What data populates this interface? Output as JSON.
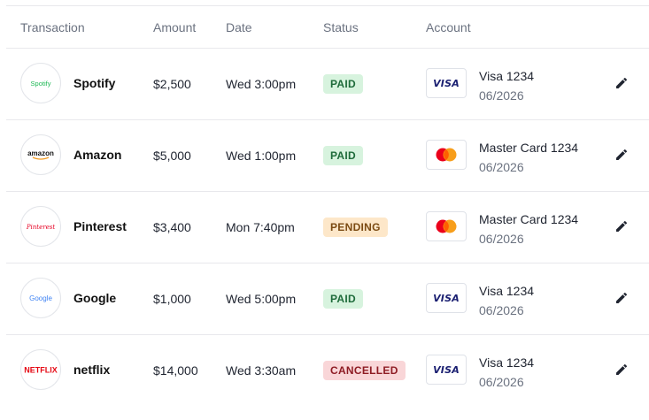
{
  "header": {
    "transaction": "Transaction",
    "amount": "Amount",
    "date": "Date",
    "status": "Status",
    "account": "Account"
  },
  "rows": [
    {
      "logo_text": "Spotify",
      "logo_color": "#1DB954",
      "name": "Spotify",
      "amount": "$2,500",
      "date": "Wed 3:00pm",
      "status": "PAID",
      "card_icon": "visa-icon",
      "card_text": "VISA",
      "account_name": "Visa 1234",
      "account_expiry": "06/2026"
    },
    {
      "logo_text": "amazon",
      "logo_color": "#111111",
      "name": "Amazon",
      "amount": "$5,000",
      "date": "Wed 1:00pm",
      "status": "PAID",
      "card_icon": "mastercard-icon",
      "account_name": "Master Card 1234",
      "account_expiry": "06/2026"
    },
    {
      "logo_text": "Pinterest",
      "logo_color": "#E60023",
      "name": "Pinterest",
      "amount": "$3,400",
      "date": "Mon 7:40pm",
      "status": "PENDING",
      "card_icon": "mastercard-icon",
      "account_name": "Master Card 1234",
      "account_expiry": "06/2026"
    },
    {
      "logo_text": "Google",
      "logo_color": "#4285F4",
      "name": "Google",
      "amount": "$1,000",
      "date": "Wed 5:00pm",
      "status": "PAID",
      "card_icon": "visa-icon",
      "card_text": "VISA",
      "account_name": "Visa 1234",
      "account_expiry": "06/2026"
    },
    {
      "logo_text": "NETFLIX",
      "logo_color": "#E50914",
      "name": "netflix",
      "amount": "$14,000",
      "date": "Wed 3:30am",
      "status": "CANCELLED",
      "card_icon": "visa-icon",
      "card_text": "VISA",
      "account_name": "Visa 1234",
      "account_expiry": "06/2026"
    }
  ],
  "colors": {
    "paid_bg": "#d7f3de",
    "pending_bg": "#fde7c9",
    "cancelled_bg": "#f9d6d8",
    "visa_blue": "#1a1f71",
    "mastercard_red": "#eb001b",
    "mastercard_orange": "#f79e1b"
  },
  "icons": {
    "edit": "pencil-icon"
  }
}
